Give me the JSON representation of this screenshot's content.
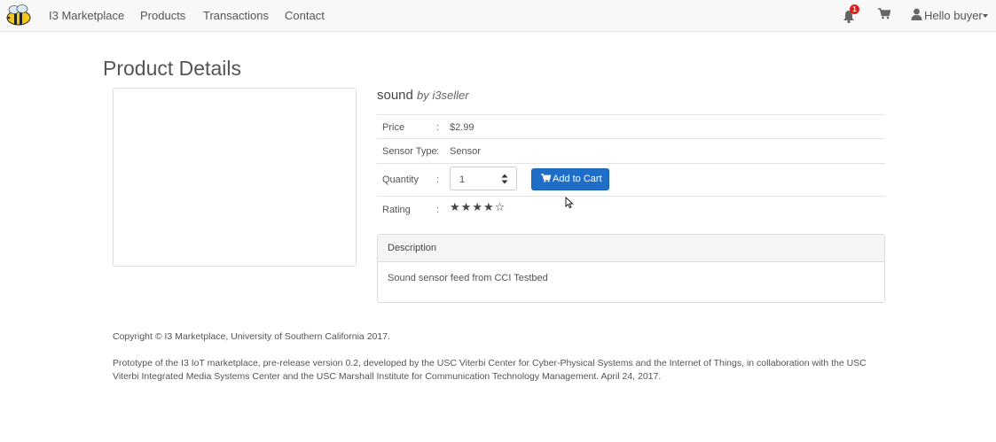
{
  "nav": {
    "brand": "I3 Marketplace",
    "links": [
      "Products",
      "Transactions",
      "Contact"
    ],
    "notification_count": "1",
    "user_label": "Hello buyer",
    "icons": {
      "logo": "bee-logo-icon",
      "bell": "bell-icon",
      "cart": "cart-icon",
      "user": "user-icon"
    }
  },
  "page": {
    "title": "Product Details",
    "product_name": "sound",
    "seller": "by i3seller",
    "price_label": "Price",
    "price_value": "$2.99",
    "sensor_type_label": "Sensor Type",
    "sensor_type_value": "Sensor",
    "quantity_label": "Quantity",
    "quantity_value": "1",
    "add_to_cart_label": "Add to Cart",
    "rating_label": "Rating",
    "rating_value": 4,
    "rating_max": 5,
    "separator": ":",
    "description_heading": "Description",
    "description_text": "Sound sensor feed from CCI Testbed"
  },
  "footer": {
    "copyright": "Copyright © I3 Marketplace, University of Southern California 2017.",
    "note": "Prototype of the I3 IoT marketplace, pre-release version 0.2, developed by the USC Viterbi Center for Cyber-Physical Systems and the Internet of Things, in collaboration with the USC Viterbi Integrated Media Systems Center and the USC Marshall Institute for Communication Technology Management. April 24, 2017."
  },
  "colors": {
    "primary_button": "#1e6ec8",
    "badge": "#d9211c",
    "navbar_bg": "#f8f8f8"
  }
}
